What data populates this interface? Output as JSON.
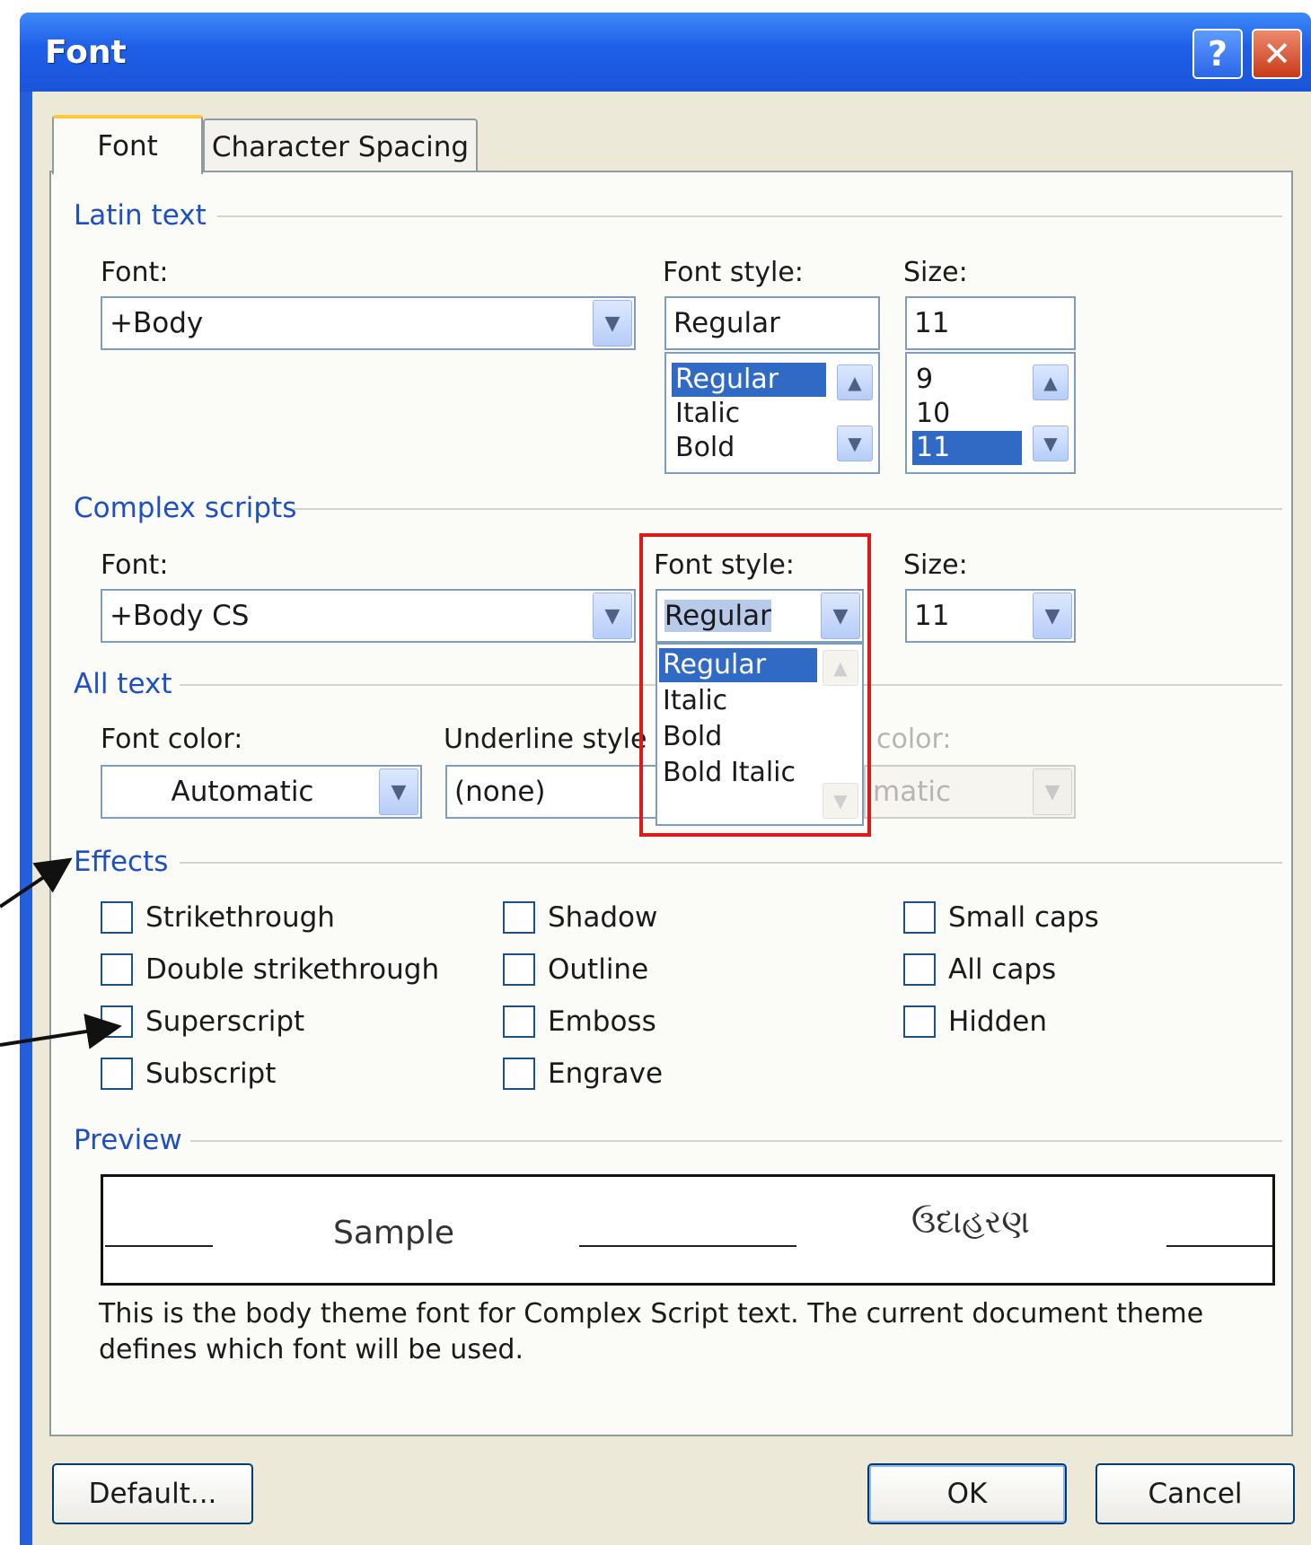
{
  "dialog": {
    "title": "Font",
    "help_glyph": "?",
    "close_glyph": "✕"
  },
  "tabs": [
    {
      "label": "Font",
      "selected": true
    },
    {
      "label": "Character Spacing",
      "selected": false
    }
  ],
  "latin_text": {
    "group_label": "Latin text",
    "font_label": "Font:",
    "font_value": "+Body",
    "style_label": "Font style:",
    "style_value": "Regular",
    "style_options": [
      "Regular",
      "Italic",
      "Bold"
    ],
    "style_selected": "Regular",
    "size_label": "Size:",
    "size_value": "11",
    "size_options": [
      "9",
      "10",
      "11"
    ],
    "size_selected": "11"
  },
  "complex_scripts": {
    "group_label": "Complex scripts",
    "font_label": "Font:",
    "font_value": "+Body CS",
    "style_label": "Font style:",
    "style_value": "Regular",
    "style_dropdown_options": [
      "Regular",
      "Italic",
      "Bold",
      "Bold Italic"
    ],
    "style_dropdown_selected": "Regular",
    "size_label": "Size:",
    "size_value": "11"
  },
  "all_text": {
    "group_label": "All text",
    "font_color_label": "Font color:",
    "font_color_value": "Automatic",
    "underline_style_label": "Underline style",
    "underline_style_value": "(none)",
    "underline_color_label_partial": "color:",
    "underline_color_value_partial": "matic"
  },
  "effects": {
    "group_label": "Effects",
    "options": [
      {
        "label": "Strikethrough",
        "checked": false
      },
      {
        "label": "Double strikethrough",
        "checked": false
      },
      {
        "label": "Superscript",
        "checked": false
      },
      {
        "label": "Subscript",
        "checked": false
      },
      {
        "label": "Shadow",
        "checked": false
      },
      {
        "label": "Outline",
        "checked": false
      },
      {
        "label": "Emboss",
        "checked": false
      },
      {
        "label": "Engrave",
        "checked": false
      },
      {
        "label": "Small caps",
        "checked": false
      },
      {
        "label": "All caps",
        "checked": false
      },
      {
        "label": "Hidden",
        "checked": false
      }
    ]
  },
  "preview": {
    "group_label": "Preview",
    "sample_latin": "Sample",
    "sample_complex": "ઉદાહરણ",
    "description": "This is the body theme font for Complex Script text. The current document theme defines which font will be used."
  },
  "buttons": {
    "default": "Default...",
    "ok": "OK",
    "cancel": "Cancel"
  },
  "colors": {
    "selection": "#316ac5",
    "group_label": "#1f4fc4",
    "annotation": "#e01818",
    "titlebar": "#245edb"
  }
}
